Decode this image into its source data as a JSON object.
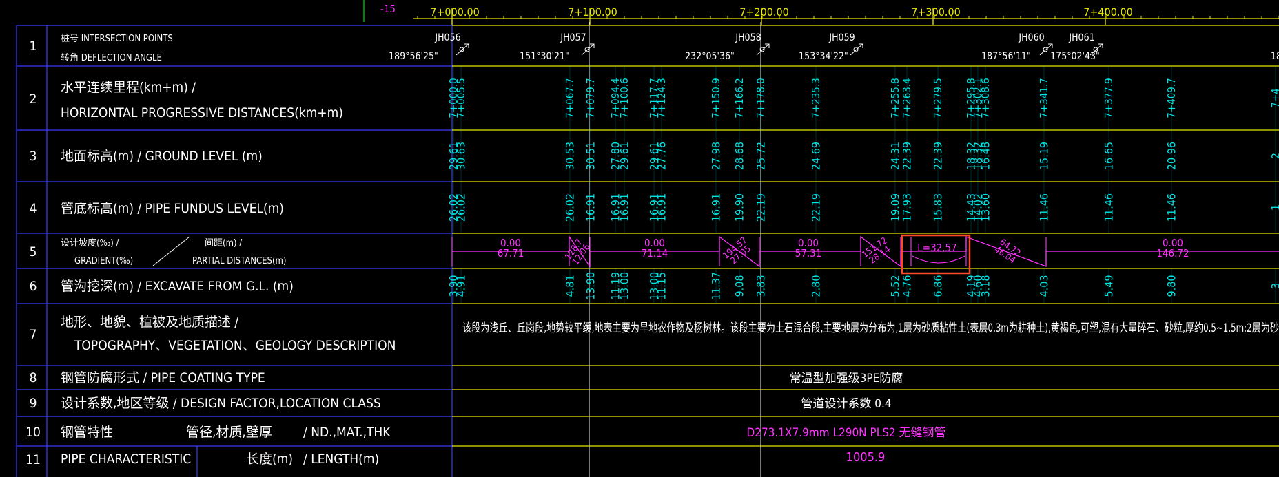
{
  "header": {
    "offset": "-15",
    "chainage": [
      "7+000.00",
      "7+100.00",
      "7+200.00",
      "7+300.00",
      "7+400.00"
    ]
  },
  "rows": [
    {
      "num": "1",
      "cn": "桩号 INTERSECTION POINTS",
      "cn2": "转角 DEFLECTION ANGLE"
    },
    {
      "num": "2",
      "cn": "水平连续里程(km+m)      /",
      "en": "HORIZONTAL PROGRESSIVE DISTANCES(km+m)"
    },
    {
      "num": "3",
      "cn": "地面标高(m)     /  GROUND LEVEL (m)"
    },
    {
      "num": "4",
      "cn": "管底标高(m)     /  PIPE FUNDUS LEVEL(m)"
    },
    {
      "num": "5",
      "cn": "设计坡度(‰)    /",
      "cn_b": "间距(m)     /",
      "en": "GRADIENT(‰)",
      "en_b": "PARTIAL DISTANCES(m)"
    },
    {
      "num": "6",
      "cn": "管沟挖深(m)    /  EXCAVATE FROM G.L. (m)"
    },
    {
      "num": "7",
      "cn": "地形、地貌、植被及地质描述        /",
      "en": "TOPOGRAPHY、VEGETATION、GEOLOGY DESCRIPTION"
    },
    {
      "num": "8",
      "cn": "钢管防腐形式   /  PIPE COATING TYPE"
    },
    {
      "num": "9",
      "cn": "设计系数,地区等级     /  DESIGN FACTOR,LOCATION CLASS"
    },
    {
      "num": "10",
      "cn": "钢管特性",
      "cn_b": "管径,材质,壁厚",
      "en_b": "/  ND.,MAT.,THK"
    },
    {
      "num": "11",
      "en": "PIPE CHARACTERISTIC",
      "cn_b": "长度(m)",
      "en_b": "/  LENGTH(m)"
    }
  ],
  "jh_points": [
    {
      "name": "JH056",
      "angle": "189°56'25\""
    },
    {
      "name": "JH057",
      "angle": "151°30'21\""
    },
    {
      "name": "JH058",
      "angle": "232°05'36\""
    },
    {
      "name": "JH059",
      "angle": "153°34'22\""
    },
    {
      "name": "JH060",
      "angle": "187°56'11\""
    },
    {
      "name": "JH061",
      "angle": "175°02'43\""
    },
    {
      "name": "",
      "angle": "18"
    }
  ],
  "stations": [
    {
      "chain": [
        "7+000.0",
        "7+005.5"
      ],
      "ground": [
        "29.61",
        "30.63"
      ],
      "pipe": [
        "26.02",
        "26.02"
      ],
      "excav": [
        "3.90",
        "4.91"
      ]
    },
    {
      "chain": [
        "7+067.7"
      ],
      "ground": [
        "30.53"
      ],
      "pipe": [
        "26.02"
      ],
      "excav": [
        "4.81"
      ]
    },
    {
      "chain": [
        "7+079.7"
      ],
      "ground": [
        "30.51"
      ],
      "pipe": [
        "16.91"
      ],
      "excav": [
        "13.90"
      ]
    },
    {
      "chain": [
        "7+094.4",
        "7+100.6"
      ],
      "ground": [
        "27.80",
        "29.61"
      ],
      "pipe": [
        "16.91",
        "16.91"
      ],
      "excav": [
        "11.19",
        "13.00"
      ]
    },
    {
      "chain": [
        "7+117.7",
        "7+124.3"
      ],
      "ground": [
        "29.61",
        "27.76"
      ],
      "pipe": [
        "16.91",
        "16.91"
      ],
      "excav": [
        "13.00",
        "11.15"
      ]
    },
    {
      "chain": [
        "7+150.9"
      ],
      "ground": [
        "27.98"
      ],
      "pipe": [
        "16.91"
      ],
      "excav": [
        "11.37"
      ]
    },
    {
      "chain": [
        "7+166.2"
      ],
      "ground": [
        "28.68"
      ],
      "pipe": [
        "19.90"
      ],
      "excav": [
        "9.08"
      ]
    },
    {
      "chain": [
        "7+178.0"
      ],
      "ground": [
        "25.72"
      ],
      "pipe": [
        "22.19"
      ],
      "excav": [
        "3.83"
      ]
    },
    {
      "chain": [
        "7+235.3"
      ],
      "ground": [
        "24.69"
      ],
      "pipe": [
        "22.19"
      ],
      "excav": [
        "2.80"
      ]
    },
    {
      "chain": [
        "7+255.8",
        "7+263.4"
      ],
      "ground": [
        "24.31",
        "22.39"
      ],
      "pipe": [
        "19.09",
        "17.93"
      ],
      "excav": [
        "5.52",
        "4.76"
      ]
    },
    {
      "chain": [
        "7+279.5"
      ],
      "ground": [
        "22.39"
      ],
      "pipe": [
        "15.83"
      ],
      "excav": [
        "6.86"
      ]
    },
    {
      "chain": [
        "7+295.8",
        "7+302.1",
        "7+308.6"
      ],
      "ground": [
        "18.32",
        "18.32",
        "16.48"
      ],
      "pipe": [
        "14.43",
        "14.02",
        "13.60"
      ],
      "excav": [
        "4.19",
        "4.60",
        "3.18"
      ]
    },
    {
      "chain": [
        "7+341.7"
      ],
      "ground": [
        "15.19"
      ],
      "pipe": [
        "11.46"
      ],
      "excav": [
        "4.03"
      ]
    },
    {
      "chain": [
        "7+377.9"
      ],
      "ground": [
        "16.65"
      ],
      "pipe": [
        "11.46"
      ],
      "excav": [
        "5.49"
      ]
    },
    {
      "chain": [
        "7+409.7"
      ],
      "ground": [
        "20.96"
      ],
      "pipe": [
        "11.46"
      ],
      "excav": [
        "9.80"
      ]
    },
    {
      "chain": [
        "7+4"
      ],
      "ground": [
        "2"
      ],
      "pipe": [
        "1"
      ],
      "excav": [
        "3"
      ]
    }
  ],
  "gradients": [
    {
      "grade": "0.00",
      "dist": "67.71"
    },
    {
      "grade": "128.7",
      "dist": "12.06"
    },
    {
      "grade": "0.00",
      "dist": "71.14"
    },
    {
      "grade": "194.57",
      "dist": "27.05"
    },
    {
      "grade": "0.00",
      "dist": "57.31"
    },
    {
      "grade": "151.72",
      "dist": "28.14"
    },
    {
      "grade": "L=32.57"
    },
    {
      "grade": "64.72",
      "dist": "46.04"
    },
    {
      "grade": "0.00",
      "dist": "146.72"
    }
  ],
  "topo_text": "该段为浅丘、丘岗段,地势较平缓,地表主要为旱地农作物及杨树林。该段主要为土石混合段,主要地层为分布为,1层为砂质粘性土(表层0.3m为耕种土),黄褐色,可塑,混有大量碎石、砂粒,厚约0.5~1.5m;2层为砂",
  "coating": "常温型加强级3PE防腐",
  "design_factor": "管道设计系数 0.4",
  "pipe_spec": "D273.1X7.9mm L290N PLS2 无缝钢管",
  "pipe_length": "1005.9",
  "colors": {
    "background": "#000000",
    "line": "#e8e800",
    "frame": "#3a3aff",
    "text": "#ffffff",
    "cyan": "#00e5e5",
    "magenta": "#ff33ff",
    "marker": "#ff4a2a",
    "axis": "#00b000"
  }
}
